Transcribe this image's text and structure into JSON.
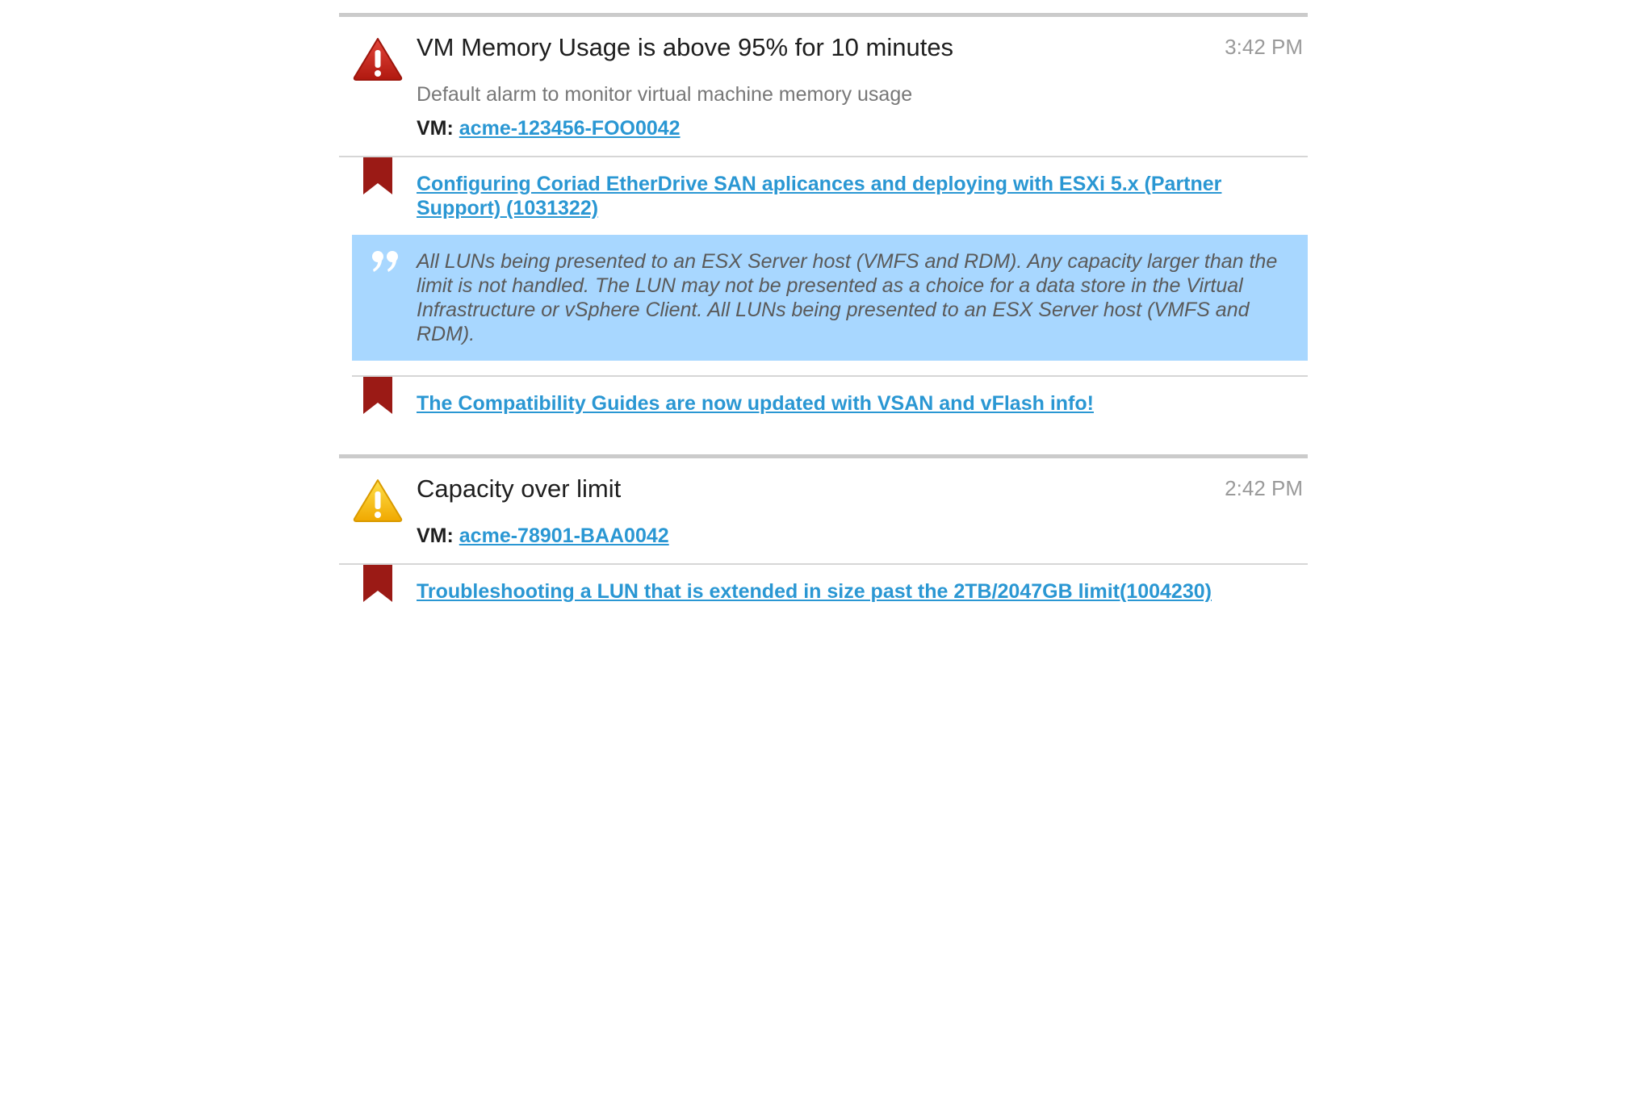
{
  "alarms": [
    {
      "title": "VM Memory Usage is above 95% for 10 minutes",
      "time": "3:42 PM",
      "severity": "critical",
      "severity_color": "#c8281e",
      "description": "Default alarm to monitor virtual machine memory usage",
      "vm_label": "VM:",
      "vm_name": "acme-123456-FOO0042",
      "articles": [
        {
          "title": "Configuring Coriad EtherDrive SAN aplicances and deploying with ESXi 5.x (Partner Support) (1031322)",
          "quote": "All LUNs being presented to an ESX Server host (VMFS and RDM). Any capacity larger than the limit is not handled. The LUN may not be presented as a choice for a data store in the Virtual Infrastructure or vSphere Client. All LUNs being presented to an ESX Server host (VMFS and RDM)."
        },
        {
          "title": "The Compatibility Guides are now updated with VSAN and vFlash info!"
        }
      ]
    },
    {
      "title": "Capacity over limit",
      "time": "2:42 PM",
      "severity": "warning",
      "severity_color": "#f2c200",
      "vm_label": "VM:",
      "vm_name": "acme-78901-BAA0042",
      "articles": [
        {
          "title": "Troubleshooting a LUN that is extended in size past the 2TB/2047GB limit(1004230)"
        }
      ]
    }
  ],
  "icons": {
    "critical": "critical-alert-icon",
    "warning": "warning-alert-icon",
    "article": "bookmark-icon",
    "quote": "quote-icon"
  },
  "colors": {
    "link": "#2a97d3",
    "bookmark": "#9b1a15",
    "quote_bg": "#a8d7ff",
    "divider": "#cbcbcb"
  }
}
